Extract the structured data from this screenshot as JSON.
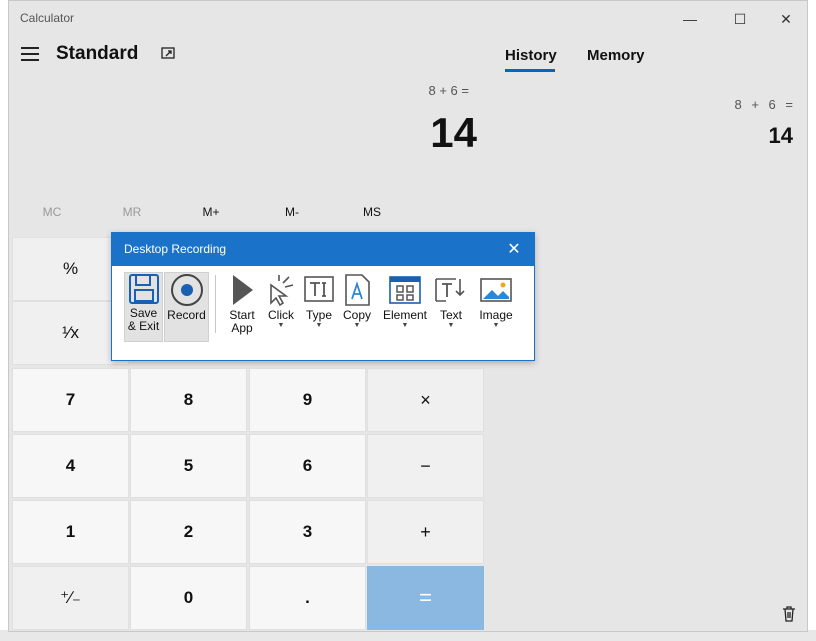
{
  "window": {
    "title": "Calculator",
    "minimize": "—",
    "maximize": "☐",
    "close": "✕"
  },
  "header": {
    "mode": "Standard"
  },
  "display": {
    "expression": "8 + 6 =",
    "result": "14"
  },
  "memory": [
    "MC",
    "MR",
    "M+",
    "M-",
    "MS"
  ],
  "tabs": {
    "history": "History",
    "memory": "Memory"
  },
  "history": {
    "expression": "8 + 6 =",
    "result": "14"
  },
  "keys": {
    "percent": "%",
    "reciprocal": "¹⁄x",
    "seven": "7",
    "eight": "8",
    "nine": "9",
    "multiply": "×",
    "four": "4",
    "five": "5",
    "six": "6",
    "minus": "−",
    "one": "1",
    "two": "2",
    "three": "3",
    "plus": "+",
    "negate": "⁺∕₋",
    "zero": "0",
    "decimal": ".",
    "equals": "="
  },
  "recording": {
    "title": "Desktop Recording",
    "close": "✕",
    "save_line1": "Save",
    "save_line2": "& Exit",
    "record": "Record",
    "start_line1": "Start",
    "start_line2": "App",
    "click": "Click",
    "type": "Type",
    "copy": "Copy",
    "element": "Element",
    "text": "Text",
    "image": "Image"
  },
  "colors": {
    "accent": "#1a73c8",
    "equals_key": "#8ab8e0"
  }
}
